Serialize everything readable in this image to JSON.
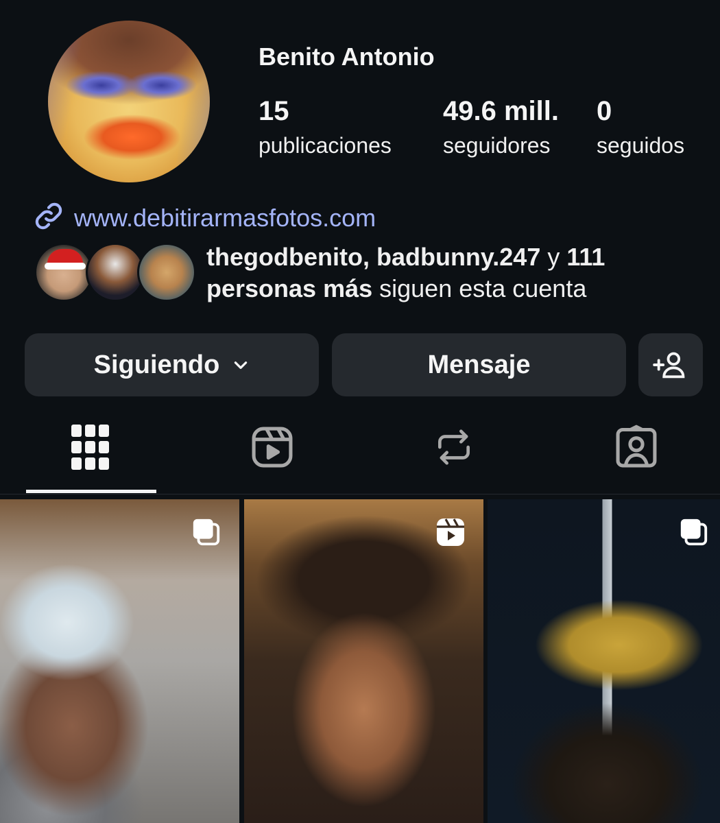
{
  "profile": {
    "name": "Benito Antonio",
    "avatar_icon": "profile-avatar"
  },
  "stats": [
    {
      "value": "15",
      "label": "publicaciones"
    },
    {
      "value": "49.6 mill.",
      "label": "seguidores"
    },
    {
      "value": "0",
      "label": "seguidos"
    }
  ],
  "website": {
    "icon": "link-icon",
    "url": "www.debitirarmasfotos.com"
  },
  "followed_by": {
    "names": "thegodbenito, badbunny.247",
    "connector": " y ",
    "count_text": "111",
    "more_bold": "personas más",
    "suffix": " siguen esta cuenta"
  },
  "actions": {
    "following_label": "Siguiendo",
    "following_icon": "chevron-down-icon",
    "message_label": "Mensaje",
    "add_user_icon": "add-user-icon"
  },
  "tabs": [
    {
      "name": "grid",
      "icon": "grid-icon",
      "active": true
    },
    {
      "name": "reels",
      "icon": "reels-icon",
      "active": false
    },
    {
      "name": "reposts",
      "icon": "repost-icon",
      "active": false
    },
    {
      "name": "tagged",
      "icon": "tagged-icon",
      "active": false
    }
  ],
  "posts": [
    {
      "badge_icon": "carousel-icon"
    },
    {
      "badge_icon": "reels-icon"
    },
    {
      "badge_icon": "carousel-icon"
    }
  ],
  "colors": {
    "background": "#0c1014",
    "button": "#25292e",
    "link": "#a4b4f8",
    "text": "#f5f5f5"
  }
}
